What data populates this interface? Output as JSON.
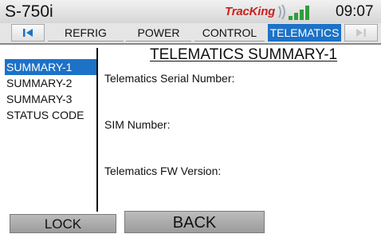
{
  "statusbar": {
    "model": "S-750i",
    "logo_text": "TracKing",
    "time": "09:07"
  },
  "tabs": {
    "items": [
      {
        "label": "REFRIG"
      },
      {
        "label": "POWER"
      },
      {
        "label": "CONTROL"
      },
      {
        "label": "TELEMATICS",
        "active": true
      }
    ],
    "prev_icon": "skip-back-icon",
    "next_icon": "skip-forward-icon"
  },
  "sidebar": {
    "items": [
      {
        "label": "SUMMARY-1",
        "selected": true
      },
      {
        "label": "SUMMARY-2"
      },
      {
        "label": "SUMMARY-3"
      },
      {
        "label": "STATUS CODE"
      }
    ]
  },
  "main": {
    "title": "TELEMATICS SUMMARY-1",
    "fields": [
      {
        "label": "Telematics Serial Number:",
        "value": ""
      },
      {
        "label": "SIM Number:",
        "value": ""
      },
      {
        "label": "Telematics FW Version:",
        "value": ""
      }
    ]
  },
  "buttons": {
    "lock": "LOCK",
    "back": "BACK"
  },
  "colors": {
    "accent": "#1c72c7",
    "logo": "#cc2020"
  }
}
